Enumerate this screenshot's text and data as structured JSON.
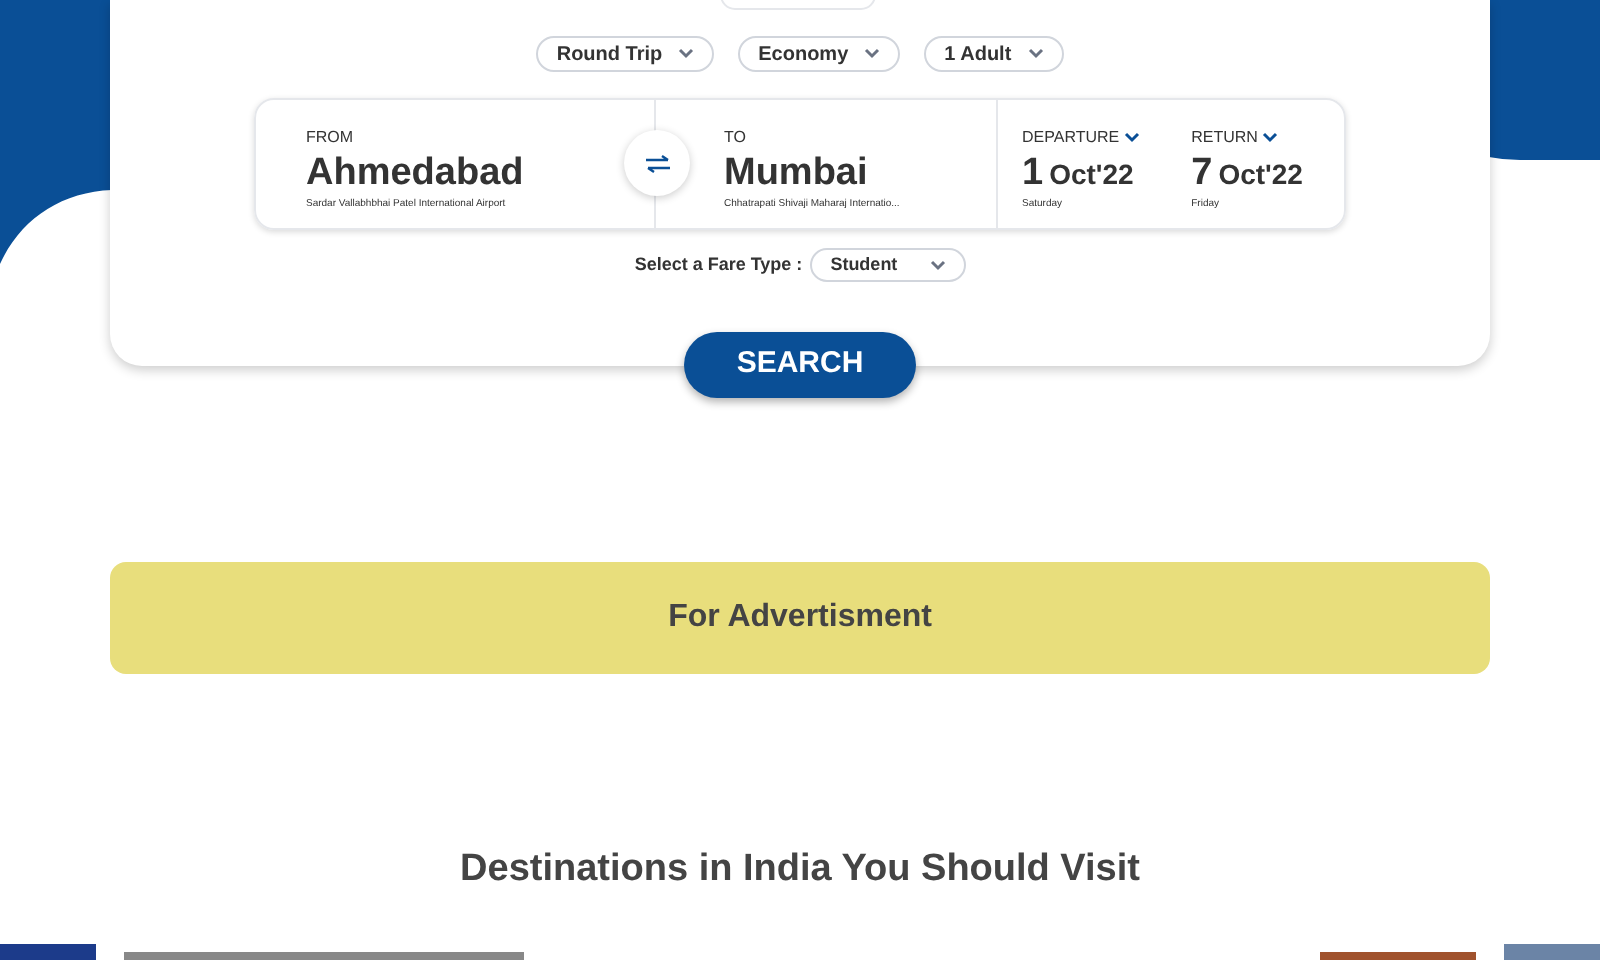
{
  "trip_options": [
    {
      "label": "Round Trip"
    },
    {
      "label": "Economy"
    },
    {
      "label": "1 Adult"
    }
  ],
  "from": {
    "label": "FROM",
    "city": "Ahmedabad",
    "airport": "Sardar Vallabhbhai Patel International Airport"
  },
  "to": {
    "label": "TO",
    "city": "Mumbai",
    "airport": "Chhatrapati Shivaji Maharaj Internatio..."
  },
  "dates": [
    {
      "label": "DEPARTURE",
      "day": "1",
      "month": "Oct'22",
      "weekday": "Saturday"
    },
    {
      "label": "RETURN",
      "day": "7",
      "month": "Oct'22",
      "weekday": "Friday"
    }
  ],
  "fare_type": {
    "label": "Select a Fare Type :",
    "value": "Student"
  },
  "search_button": "SEARCH",
  "advertisement": "For Advertisment",
  "section_title": "Destinations in India You Should Visit"
}
